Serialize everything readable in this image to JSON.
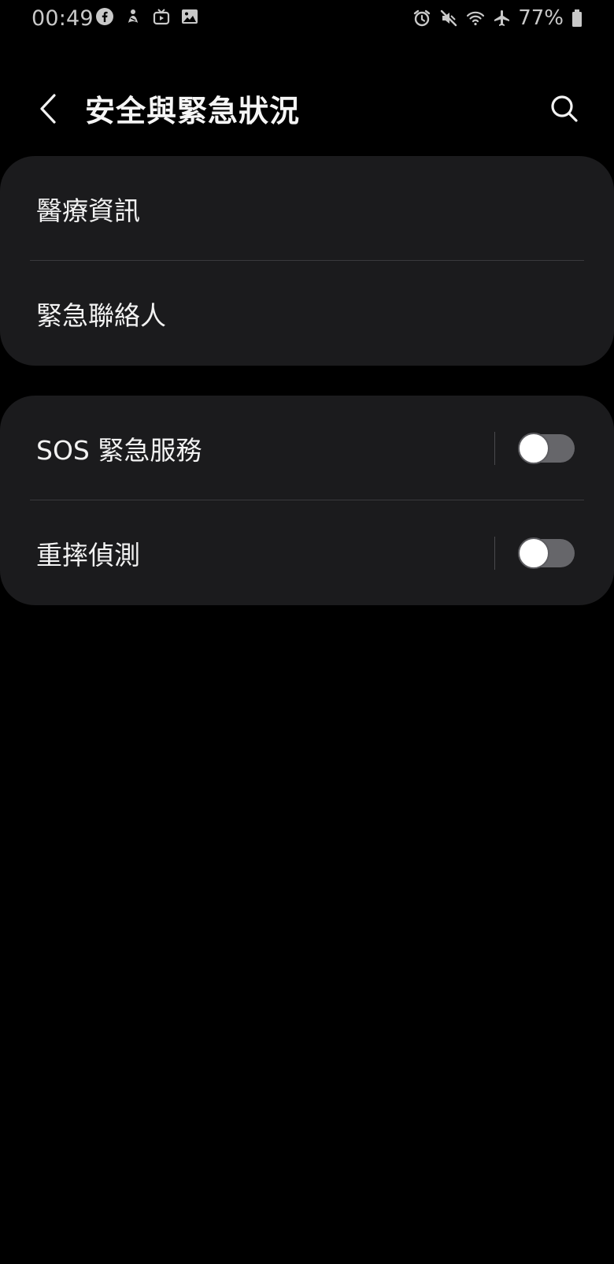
{
  "status_bar": {
    "time": "00:49",
    "left_icons": [
      "facebook-icon",
      "app-notification-icon",
      "tv-icon",
      "gallery-icon"
    ],
    "right_icons": [
      "alarm-icon",
      "mute-icon",
      "wifi-icon",
      "airplane-mode-icon"
    ],
    "battery_percent": "77%"
  },
  "header": {
    "title": "安全與緊急狀況"
  },
  "cards": [
    {
      "items": [
        {
          "label": "醫療資訊"
        },
        {
          "label": "緊急聯絡人"
        }
      ]
    },
    {
      "items": [
        {
          "label": "SOS 緊急服務",
          "toggle_on": false
        },
        {
          "label": "重摔偵測",
          "toggle_on": false
        }
      ]
    }
  ],
  "colors": {
    "background": "#000000",
    "card": "#1b1b1d",
    "text": "#f2f2f2",
    "toggle_track_off": "#66666a",
    "toggle_thumb": "#ffffff"
  }
}
